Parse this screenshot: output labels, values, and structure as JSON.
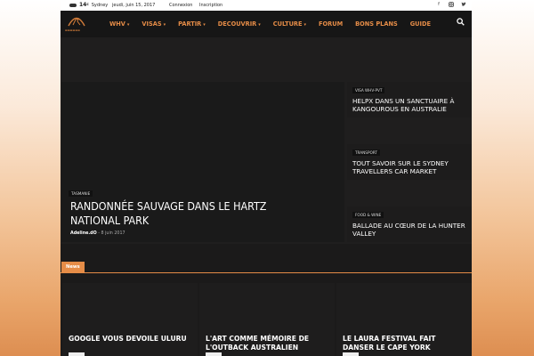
{
  "topbar": {
    "temperature": "14",
    "degree": "c",
    "city": "Sydney",
    "date": "jeudi, juin 15, 2017",
    "login": "Connexion",
    "signup": "Inscription"
  },
  "nav": {
    "items": [
      {
        "label": "WHV",
        "has_dropdown": true
      },
      {
        "label": "VISAS",
        "has_dropdown": true
      },
      {
        "label": "PARTIR",
        "has_dropdown": true
      },
      {
        "label": "DECOUVRIR",
        "has_dropdown": true
      },
      {
        "label": "CULTURE",
        "has_dropdown": true
      },
      {
        "label": "FORUM",
        "has_dropdown": false
      },
      {
        "label": "BONS PLANS",
        "has_dropdown": false
      },
      {
        "label": "GUIDE",
        "has_dropdown": false
      }
    ],
    "chevron": "▾"
  },
  "hero": {
    "main": {
      "tag": "TASMANIE",
      "title": "RANDONNÉE SAUVAGE DANS LE HARTZ NATIONAL PARK",
      "author": "Adeline.dO",
      "separator": "-",
      "date": "8 juin 2017"
    },
    "side": [
      {
        "tag": "VISA WHV-PVT",
        "title": "HELPX DANS UN SANCTUAIRE À KANGOUROUS EN AUSTRALIE"
      },
      {
        "tag": "TRANSPORT",
        "title": "TOUT SAVOIR SUR LE SYDNEY TRAVELLERS CAR MARKET"
      },
      {
        "tag": "FOOD & WINE",
        "title": "BALLADE AU CŒUR DE LA HUNTER VALLEY"
      }
    ]
  },
  "news": {
    "label": "News",
    "cards": [
      {
        "title": "GOOGLE VOUS DEVOILE ULURU"
      },
      {
        "title": "L'ART COMME MÉMOIRE DE L'OUTBACK AUSTRALIEN"
      },
      {
        "title": "LE LAURA FESTIVAL FAIT DANSER LE CAPE YORK"
      }
    ]
  },
  "colors": {
    "accent": "#e58c47",
    "nav_bg": "#161616",
    "page_bg": "#1b1a1a"
  },
  "icons": {
    "weather": "cloud-icon",
    "facebook": "facebook-icon",
    "instagram": "instagram-icon",
    "twitter": "twitter-icon",
    "search": "search-icon"
  }
}
